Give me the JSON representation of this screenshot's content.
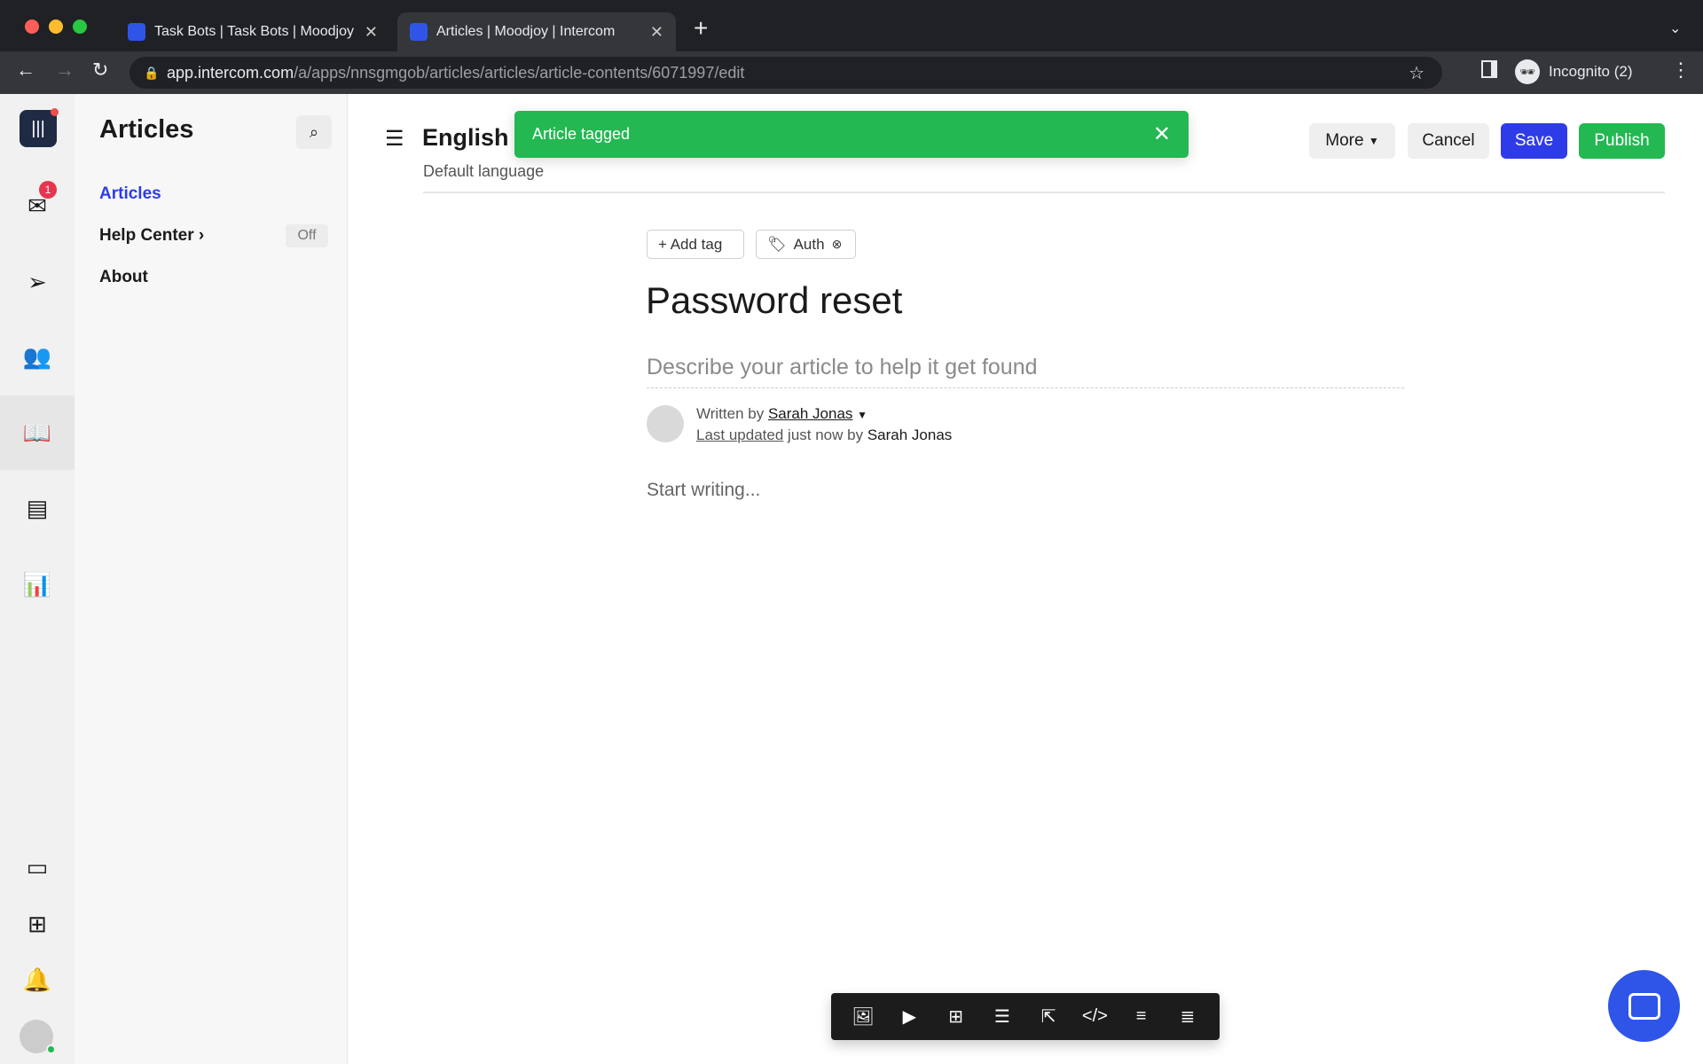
{
  "browser": {
    "tabs": [
      {
        "title": "Task Bots | Task Bots | Moodjoy"
      },
      {
        "title": "Articles | Moodjoy | Intercom"
      }
    ],
    "url_host": "app.intercom.com",
    "url_path": "/a/apps/nnsgmgob/articles/articles/article-contents/6071997/edit",
    "profile": "Incognito (2)"
  },
  "rail": {
    "inbox_badge": "1"
  },
  "sidebar": {
    "title": "Articles",
    "items": [
      {
        "label": "Articles"
      },
      {
        "label": "Help Center",
        "status": "Off"
      },
      {
        "label": "About"
      }
    ]
  },
  "header": {
    "title": "English",
    "subtitle": "Default language",
    "more": "More",
    "cancel": "Cancel",
    "save": "Save",
    "publish": "Publish"
  },
  "toast": {
    "message": "Article tagged",
    "color": "#23b852"
  },
  "article": {
    "add_tag": "+ Add tag",
    "tags": [
      "Auth"
    ],
    "title": "Password reset",
    "description_placeholder": "Describe your article to help it get found",
    "written_by": "Written by",
    "author": "Sarah Jonas",
    "last_updated": "Last updated",
    "updated_text": "just now by",
    "updated_by": "Sarah Jonas",
    "body_placeholder": "Start writing..."
  },
  "colors": {
    "accent": "#2e3ce8",
    "publish": "#23b852",
    "toolbar": "#1c1c1c"
  }
}
